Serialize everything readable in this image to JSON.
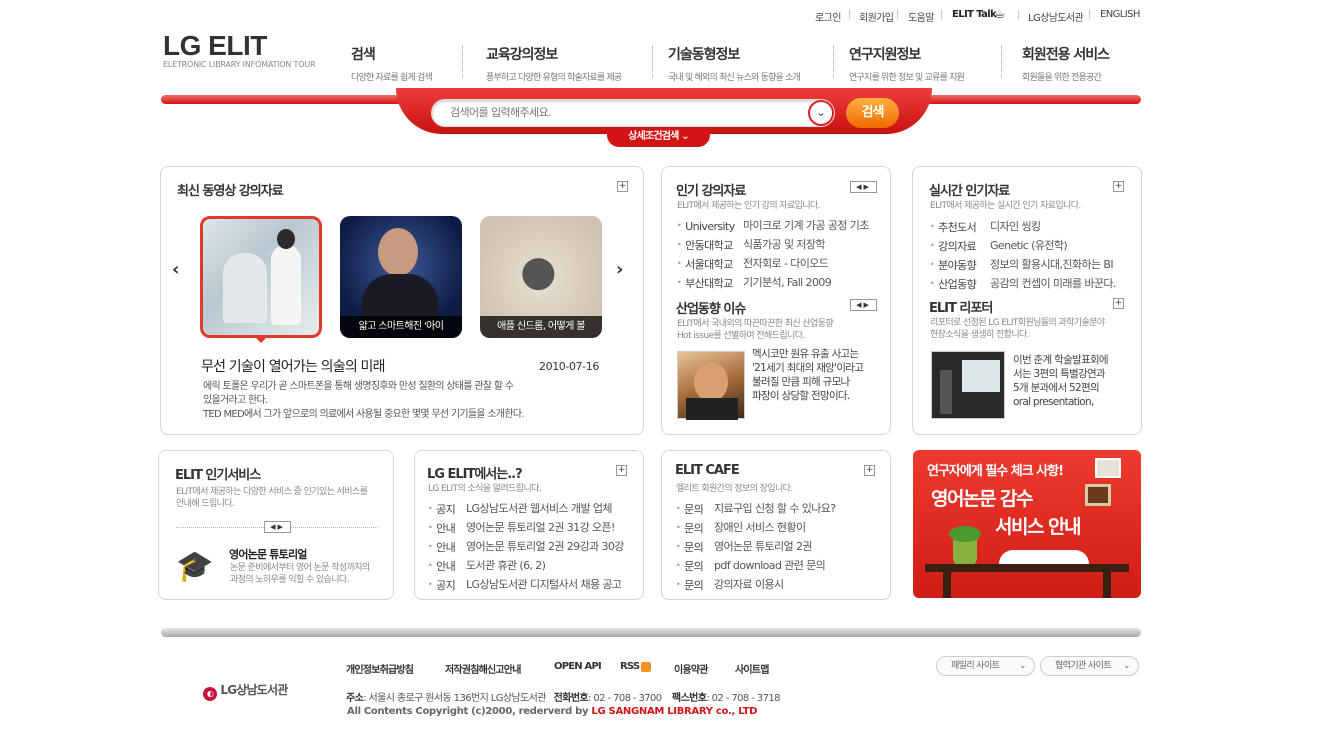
{
  "topnav": {
    "login": "로그인",
    "join": "회원가입",
    "help": "도움말",
    "talk": "ELIT Talk",
    "library": "LG상남도서관",
    "english": "ENGLISH"
  },
  "logo": {
    "title": "LG ELIT",
    "subtitle": "ELETRONIC LIBRARY INFOMATION TOUR"
  },
  "mainnav": [
    {
      "title": "검색",
      "sub": "다양한 자료를 쉽게 검색"
    },
    {
      "title": "교육강의정보",
      "sub": "풍부하고 다양한 유형의 학술자료를 제공"
    },
    {
      "title": "기술동형정보",
      "sub": "국내 및 해외의 최신 뉴스와 동향을 소개"
    },
    {
      "title": "연구지원정보",
      "sub": "연구지를 위한 정보 및 교류를 지원"
    },
    {
      "title": "회원전용 서비스",
      "sub": "회원들을 위한 전용공간"
    }
  ],
  "search": {
    "placeholder": "검색어를 입력해주세요.",
    "button": "검색",
    "advanced": "상세조건검색"
  },
  "video": {
    "title": "최신 동영상 강의자료",
    "thumbs": [
      {
        "caption": ""
      },
      {
        "caption": "얇고 스마트해진 '아이"
      },
      {
        "caption": "애플 신드롬, 어떻게 볼"
      }
    ],
    "headline": "무선 기술이 열어가는 의술의 미래",
    "date": "2010-07-16",
    "desc1": "에릭 토폴은 우리가 곧 스마트폰을 통해 생명징후와 만성 질환의 상태를 관찰 할 수",
    "desc2": "있을거라고 한다.",
    "desc3": "TED MED에서 그가 앞으로의 의료에서 사용될 중요한 몇몇 무선 기기들을 소개한다."
  },
  "popular": {
    "title": "인기 강의자료",
    "desc": "ELIT에서 제공하는 인기 강의 자료입니다.",
    "items": [
      {
        "cat": "University",
        "text": "마이크로 기계 가공 공정 기초"
      },
      {
        "cat": "안동대학교",
        "text": "식품가공 및 저장학"
      },
      {
        "cat": "서울대학교",
        "text": "전자회로 - 다이오드"
      },
      {
        "cat": "부산대학교",
        "text": "기기분석, Fall 2009"
      }
    ]
  },
  "industry": {
    "title": "산업동향 이슈",
    "desc1": "ELIT에서 국내외의 따끈따끈한 최신 산업동향",
    "desc2": "Hot issue를 선별하여 전해드립니다.",
    "text1": "멕시코만 원유 유출 사고는",
    "text2": "'21세기 최대의 재앙'이라고",
    "text3": "불려질 만큼 피해 규모나",
    "text4": "파장이 상당할 전망이다."
  },
  "realtime": {
    "title": "실시간 인기자료",
    "desc": "ELIT에서 제공하는 실시간 인기 자료입니다.",
    "items": [
      {
        "cat": "추천도서",
        "text": "디자인 씽킹"
      },
      {
        "cat": "강의자료",
        "text": "Genetic (유전학)"
      },
      {
        "cat": "분야동향",
        "text": "정보의 활용시대,진화하는 BI"
      },
      {
        "cat": "산업동향",
        "text": "공감의 컨셉이 미래를 바꾼다."
      }
    ]
  },
  "reporter": {
    "title": "ELIT 리포터",
    "desc1": "리포터로 선정된 LG ELIT회원님들의 과학기술분야",
    "desc2": "현장소식을 생생히 전합니다.",
    "text1": "이번 춘계 학술발표회에",
    "text2": "서는 3편의 특별강연과",
    "text3": "5개 분과에서 52편의",
    "text4": "oral presentation,"
  },
  "service": {
    "title": "ELIT 인기서비스",
    "desc1": "ELIT에서 제공하는 다양한 서비스 중 인기있는 서비스를",
    "desc2": "안내해 드립니다.",
    "item_title": "영어논문 튜토리얼",
    "item_desc1": "논문 준비에서부터 영어 논문 작성까지의",
    "item_desc2": "과정의 노하우를 익힐 수 있습니다."
  },
  "news": {
    "title": "LG ELIT에서는..?",
    "desc": "LG ELIT의 소식을 알려드립니다.",
    "items": [
      {
        "cat": "공지",
        "text": "LG상남도서관 웹서비스 개발 업체"
      },
      {
        "cat": "안내",
        "text": "영어논문 튜토리얼 2권 31강 오픈!"
      },
      {
        "cat": "안내",
        "text": "영어논문 튜토리얼 2권 29강과 30강"
      },
      {
        "cat": "안내",
        "text": "도서관 휴관 (6, 2)"
      },
      {
        "cat": "공지",
        "text": "LG상남도서관 디지털사서 채용 공고"
      }
    ]
  },
  "cafe": {
    "title": "ELIT CAFE",
    "desc": "엘리트 회원간의 정보의 장입니다.",
    "items": [
      {
        "cat": "문의",
        "text": "지료구입 신청 할 수 있나요?"
      },
      {
        "cat": "문의",
        "text": "장애인 서비스 현황이"
      },
      {
        "cat": "문의",
        "text": "영어논문 튜토리얼 2권"
      },
      {
        "cat": "문의",
        "text": "pdf download 관련 문의"
      },
      {
        "cat": "문의",
        "text": "강의자료 이용시"
      }
    ]
  },
  "banner": {
    "line1": "연구자에게 필수 체크 사항!",
    "line2": "영어논문 감수",
    "line3": "서비스 안내",
    "bg": "#e02a22"
  },
  "footer": {
    "logo": "LG상남도서관",
    "links": [
      "개인정보취급방침",
      "저작권침해신고안내",
      "OPEN API",
      "RSS",
      "이용약관",
      "사이트맵"
    ],
    "family": "패밀리 사이트",
    "partner": "협력기관 사이트",
    "addr_label": "주소",
    "addr": ": 서울시 종로구 원서동 136번지 LG상남도서관",
    "tel_label": "전화번호",
    "tel": ": 02 - 708 - 3700",
    "fax_label": "팩스번호",
    "fax": ": 02 - 708 - 3718",
    "copyright": "All Contents Copyright (c)2000, rederverd by",
    "copyright_org": "LG SANGNAM LIBRARY co., LTD"
  }
}
